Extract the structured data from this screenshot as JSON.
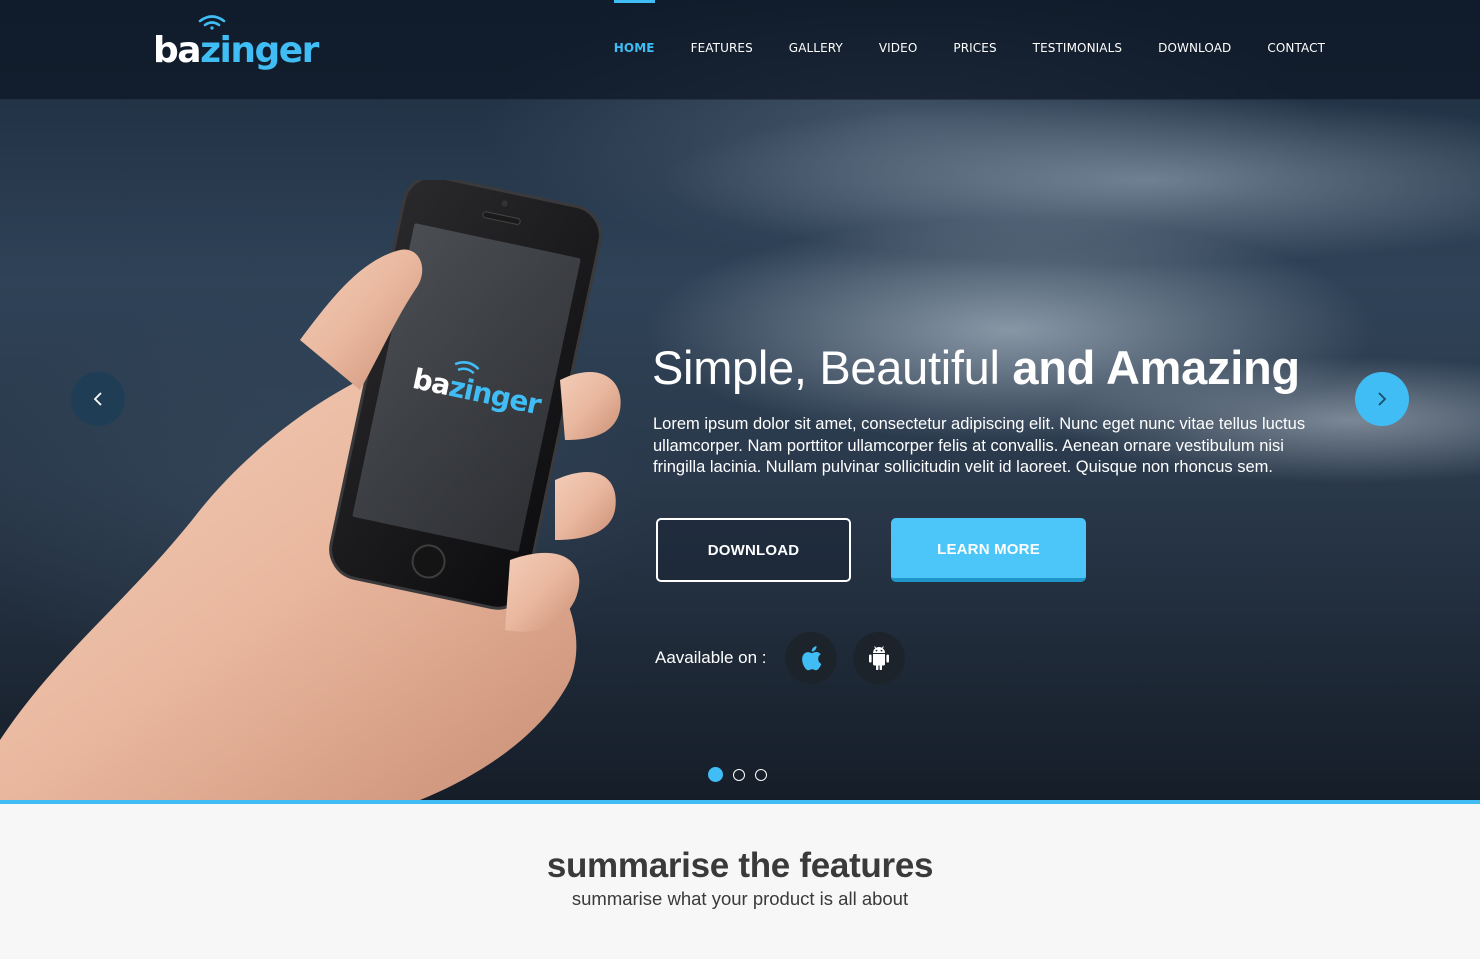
{
  "brand": {
    "logo_part1": "ba",
    "logo_part2": "zinger",
    "accent_color": "#3fbdf4"
  },
  "nav": {
    "items": [
      {
        "label": "HOME",
        "active": true
      },
      {
        "label": "FEATURES"
      },
      {
        "label": "GALLERY"
      },
      {
        "label": "VIDEO"
      },
      {
        "label": "PRICES"
      },
      {
        "label": "TESTIMONIALS"
      },
      {
        "label": "DOWNLOAD"
      },
      {
        "label": "CONTACT"
      }
    ]
  },
  "hero": {
    "headline_light": "Simple, Beautiful",
    "headline_bold": "and Amazing",
    "lead": "Lorem ipsum dolor sit amet, consectetur adipiscing elit. Nunc eget nunc vitae tellus luctus ullamcorper. Nam porttitor ullamcorper felis at convallis. Aenean ornare vestibulum nisi fringilla lacinia. Nullam pulvinar sollicitudin velit id laoreet. Quisque non rhoncus sem.",
    "download_label": "DOWNLOAD",
    "learn_more_label": "LEARN MORE",
    "available_label": "Aavailable on :",
    "stores": [
      "apple-icon",
      "android-icon"
    ],
    "phone_screen_logo_part1": "ba",
    "phone_screen_logo_part2": "zinger",
    "slides_total": 3,
    "slide_active": 1
  },
  "features": {
    "title": "summarise the features",
    "subtitle": "summarise what your product is all about"
  }
}
